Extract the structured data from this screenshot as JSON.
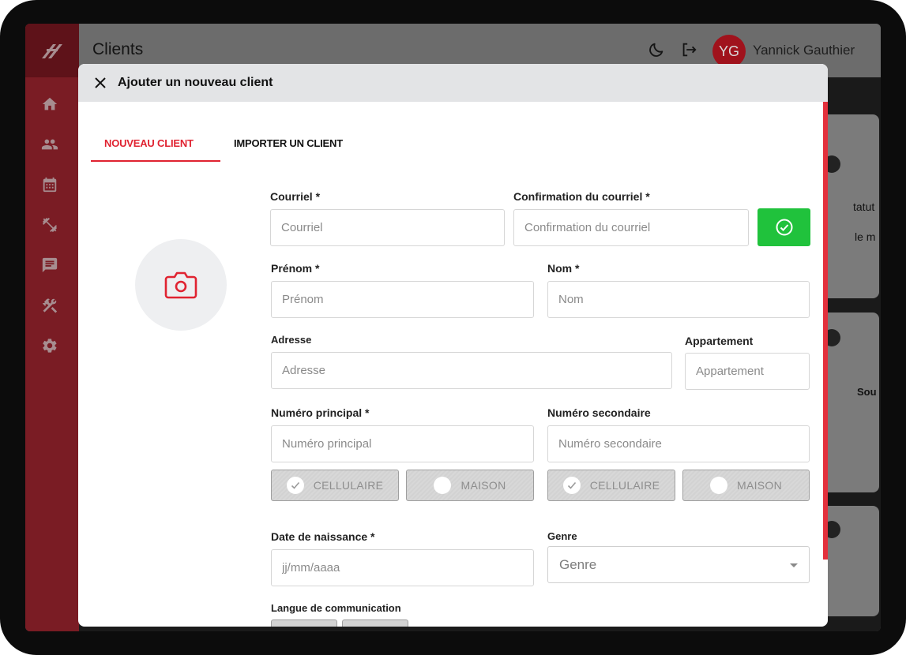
{
  "app": {
    "page_title": "Clients",
    "user_initials": "YG",
    "user_name": "Yannick Gauthier"
  },
  "sidebar": {
    "items": [
      {
        "icon": "home-icon"
      },
      {
        "icon": "people-icon"
      },
      {
        "icon": "calendar-icon"
      },
      {
        "icon": "dumbbell-icon"
      },
      {
        "icon": "chat-icon"
      },
      {
        "icon": "tools-icon"
      },
      {
        "icon": "gear-icon"
      }
    ]
  },
  "background": {
    "text_1": "tatut",
    "text_2": "le m",
    "text_3": "Sou"
  },
  "modal": {
    "title": "Ajouter un nouveau client",
    "tabs": [
      "NOUVEAU CLIENT",
      "IMPORTER UN CLIENT"
    ],
    "fields": {
      "email": {
        "label": "Courriel *",
        "placeholder": "Courriel"
      },
      "email_confirm": {
        "label": "Confirmation du courriel *",
        "placeholder": "Confirmation du courriel"
      },
      "first_name": {
        "label": "Prénom *",
        "placeholder": "Prénom"
      },
      "last_name": {
        "label": "Nom *",
        "placeholder": "Nom"
      },
      "address": {
        "label": "Adresse",
        "placeholder": "Adresse"
      },
      "apartment": {
        "label": "Appartement",
        "placeholder": "Appartement"
      },
      "primary_phone": {
        "label": "Numéro principal *",
        "placeholder": "Numéro principal"
      },
      "secondary_phone": {
        "label": "Numéro secondaire",
        "placeholder": "Numéro secondaire"
      },
      "birth_date": {
        "label": "Date de naissance *",
        "placeholder": "jj/mm/aaaa"
      },
      "gender": {
        "label": "Genre",
        "value": "Genre"
      },
      "language": {
        "label": "Langue de communication"
      }
    },
    "phone_types": {
      "cell": "CELLULAIRE",
      "home": "MAISON"
    }
  },
  "colors": {
    "accent": "#e02331",
    "confirm": "#20c23c",
    "sidebar": "#7a1c24"
  }
}
